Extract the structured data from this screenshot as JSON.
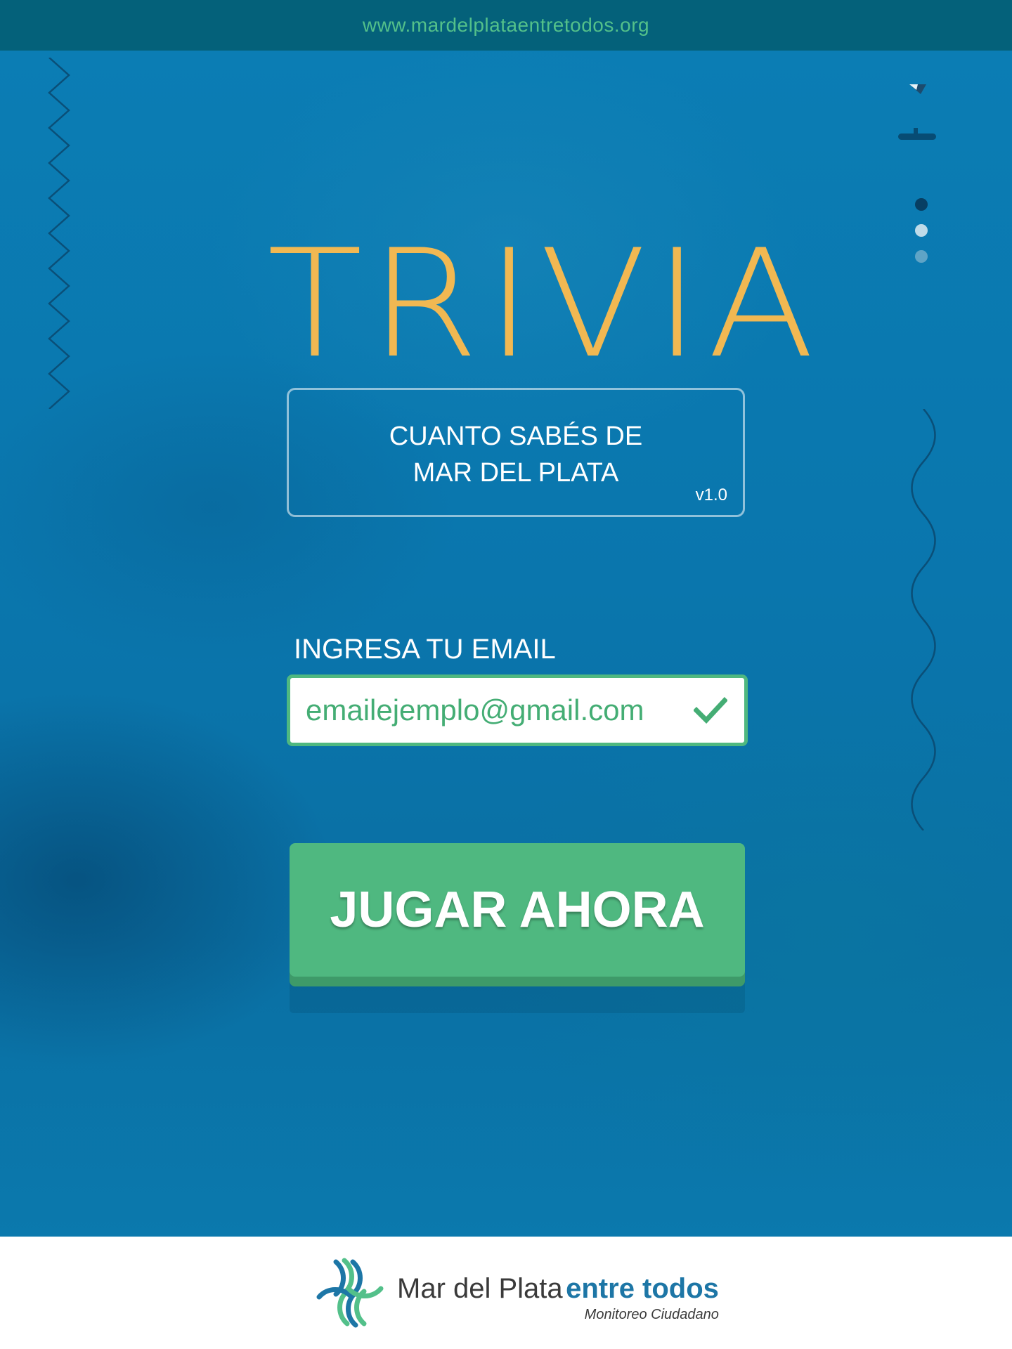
{
  "header": {
    "url": "www.mardelplataentretodos.org"
  },
  "game": {
    "title": "TRIVIA",
    "subtitle_line1": "CUANTO SABÉS DE",
    "subtitle_line2": "MAR DEL PLATA",
    "version": "v1.0"
  },
  "email": {
    "label": "INGRESA TU EMAIL",
    "value": "emailejemplo@gmail.com",
    "valid": true
  },
  "actions": {
    "play_label": "JUGAR AHORA"
  },
  "footer": {
    "brand_main": "Mar del Plata",
    "brand_accent": "entre todos",
    "brand_sub": "Monitoreo Ciudadano"
  },
  "decor": {
    "dots": [
      "dark",
      "light",
      "medium"
    ],
    "icons": [
      "zigzag-line",
      "wave-line",
      "corner-triangle",
      "dash-mark",
      "check-icon",
      "brand-logo"
    ]
  },
  "colors": {
    "topbar": "#04617a",
    "url_text": "#53c08a",
    "title": "#f1b852",
    "accent_green": "#4fb880",
    "brand_blue": "#1d76a6"
  }
}
